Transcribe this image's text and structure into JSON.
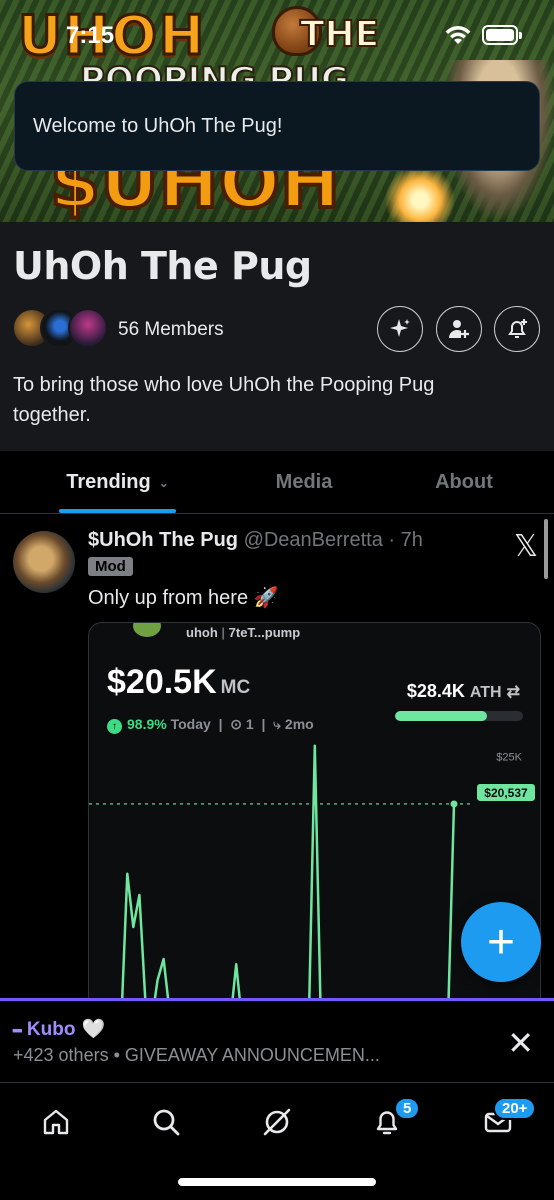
{
  "status_bar": {
    "time": "7:15"
  },
  "banner": {
    "logo_main": "UHOH",
    "logo_the": "THE",
    "logo_line2": "POOPING PUG",
    "ticker": "$UHOH"
  },
  "toast": {
    "message": "Welcome to UhOh The Pug!"
  },
  "community": {
    "name": "UhOh The Pug",
    "members": "56 Members",
    "description": "To bring those who love UhOh the Pooping Pug together."
  },
  "tabs": [
    {
      "label": "Trending"
    },
    {
      "label": "Media"
    },
    {
      "label": "About"
    }
  ],
  "post": {
    "author_name": "$UhOh The Pug",
    "handle": "@DeanBerretta",
    "time": "· 7h",
    "role_badge": "Mod",
    "text": "Only up from here 🚀",
    "x_logo": "𝕏",
    "embed": {
      "token": "uhoh",
      "address": "7teT...pump",
      "market_cap": "$20.5K",
      "mc_label": "MC",
      "ath_value": "$28.4K",
      "ath_label": "ATH",
      "ath_progress": 0.72,
      "change": "98.9%",
      "period": "Today",
      "holders": "1",
      "age": "2mo"
    }
  },
  "chart_data": {
    "type": "line",
    "title": "",
    "xlabel": "",
    "ylabel": "",
    "ylim": [
      0,
      30000
    ],
    "y_ticks": [
      "$25K"
    ],
    "current_value_label": "$20,537",
    "current_value": 20537,
    "series": [
      {
        "values": [
          0,
          0,
          0,
          0,
          0,
          14000,
          9000,
          12000,
          2000,
          0,
          4000,
          6000,
          1000,
          0,
          0,
          0,
          0,
          0,
          0,
          1500,
          0,
          0,
          0,
          5500,
          0,
          0,
          0,
          0,
          0,
          0,
          0,
          0,
          0,
          0,
          0,
          0,
          26000,
          0,
          0,
          0,
          0,
          0,
          0,
          0,
          0,
          0,
          0,
          0,
          0,
          0,
          0,
          0,
          0,
          0,
          0,
          0,
          0,
          0,
          0,
          20537
        ]
      }
    ],
    "colors": {
      "line": "#6fe6a0"
    }
  },
  "fab": {
    "label": "+"
  },
  "space": {
    "host": "Kubo",
    "host_emoji": "🤍",
    "subtitle": "+423 others • GIVEAWAY ANNOUNCEMEN...",
    "close": "✕"
  },
  "nav": {
    "notifications_badge": "5",
    "messages_badge": "20+"
  }
}
